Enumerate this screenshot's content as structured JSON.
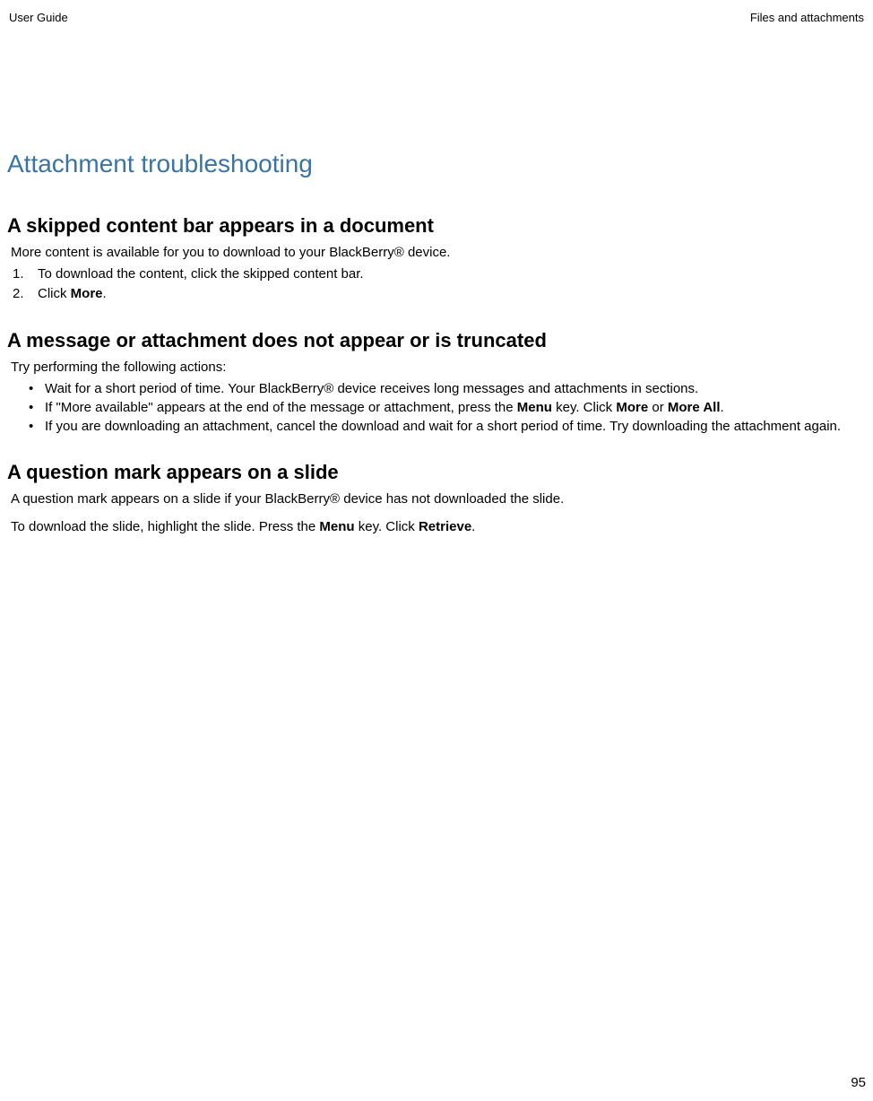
{
  "header": {
    "left": "User Guide",
    "right": "Files and attachments"
  },
  "main_title": "Attachment troubleshooting",
  "section1": {
    "heading": "A skipped content bar appears in a document",
    "intro": "More content is available for you to download to your BlackBerry® device.",
    "step1_num": "1.",
    "step1_text": "To download the content, click the skipped content bar.",
    "step2_num": "2.",
    "step2_text_a": "Click ",
    "step2_text_b": "More",
    "step2_text_c": "."
  },
  "section2": {
    "heading": "A message or attachment does not appear or is truncated",
    "intro": "Try performing the following actions:",
    "b1": "Wait for a short period of time. Your BlackBerry® device receives long messages and attachments in sections.",
    "b2_a": "If \"More available\" appears at the end of the message or attachment, press the ",
    "b2_b": "Menu",
    "b2_c": " key. Click ",
    "b2_d": "More",
    "b2_e": " or ",
    "b2_f": "More All",
    "b2_g": ".",
    "b3": "If you are downloading an attachment, cancel the download and wait for a short period of time. Try downloading the attachment again."
  },
  "section3": {
    "heading": "A question mark appears on a slide",
    "p1": "A question mark appears on a slide if your BlackBerry® device has not downloaded the slide.",
    "p2_a": "To download the slide, highlight the slide. Press the ",
    "p2_b": "Menu",
    "p2_c": " key. Click ",
    "p2_d": "Retrieve",
    "p2_e": "."
  },
  "page_number": "95",
  "bullet_glyph": "•"
}
